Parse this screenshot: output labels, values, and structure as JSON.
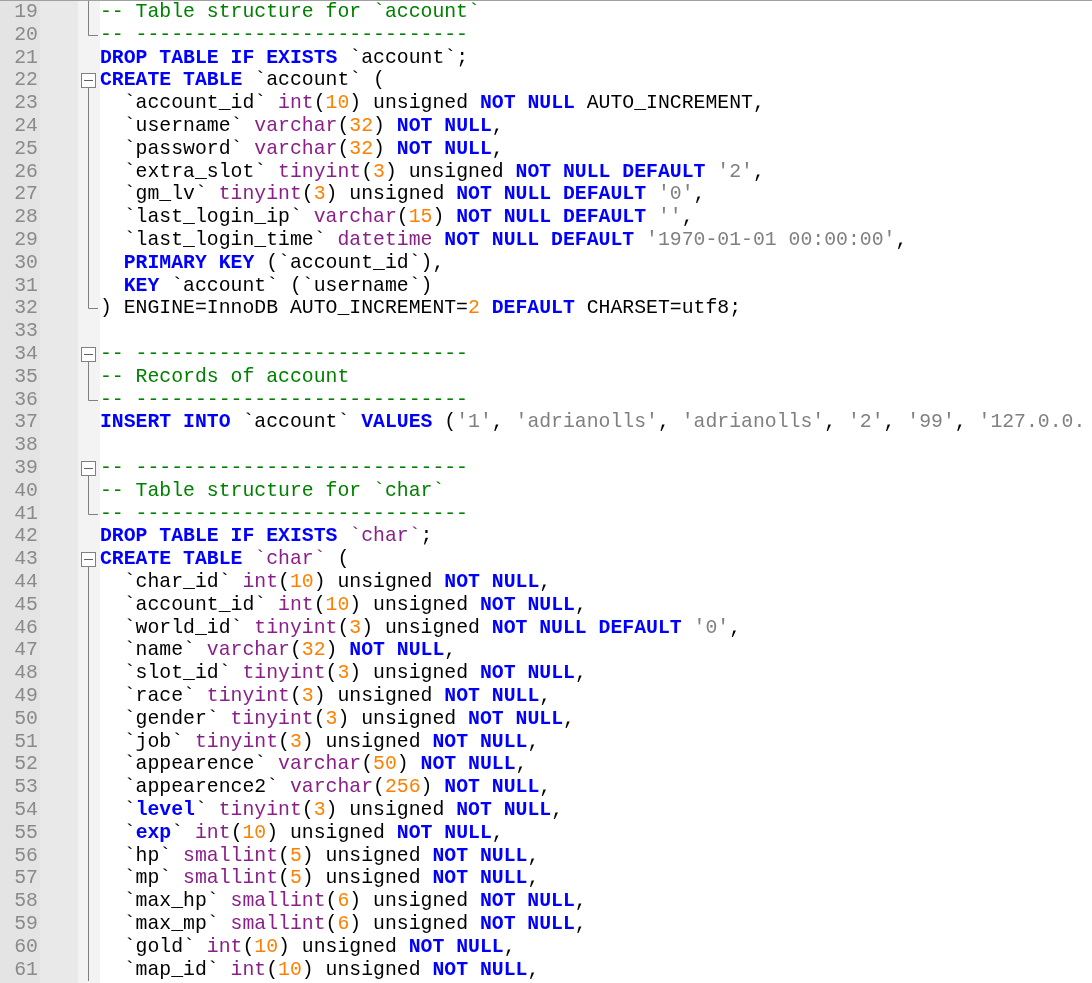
{
  "editor": {
    "lines": [
      {
        "number": "19",
        "kind": "body",
        "indented": false,
        "tokens": [
          {
            "kind": "comment",
            "text": "-- Table structure for `account`"
          }
        ]
      },
      {
        "number": "20",
        "kind": "end",
        "indented": false,
        "tokens": [
          {
            "kind": "comment",
            "text": "-- ----------------------------"
          }
        ]
      },
      {
        "number": "21",
        "kind": "plain",
        "indented": false,
        "tokens": [
          {
            "kind": "keyword",
            "text": "DROP TABLE IF EXISTS"
          },
          {
            "kind": "plain",
            "text": " `account`;"
          }
        ]
      },
      {
        "number": "22",
        "kind": "start",
        "indented": false,
        "tokens": [
          {
            "kind": "keyword",
            "text": "CREATE TABLE"
          },
          {
            "kind": "plain",
            "text": " `account` ("
          }
        ]
      },
      {
        "number": "23",
        "kind": "body",
        "indented": true,
        "tokens": [
          {
            "kind": "plain",
            "text": "`account_id` "
          },
          {
            "kind": "type",
            "text": "int"
          },
          {
            "kind": "plain",
            "text": "("
          },
          {
            "kind": "number",
            "text": "10"
          },
          {
            "kind": "plain",
            "text": ") unsigned "
          },
          {
            "kind": "keyword",
            "text": "NOT NULL"
          },
          {
            "kind": "plain",
            "text": " AUTO_INCREMENT,"
          }
        ]
      },
      {
        "number": "24",
        "kind": "body",
        "indented": true,
        "tokens": [
          {
            "kind": "plain",
            "text": "`username` "
          },
          {
            "kind": "type",
            "text": "varchar"
          },
          {
            "kind": "plain",
            "text": "("
          },
          {
            "kind": "number",
            "text": "32"
          },
          {
            "kind": "plain",
            "text": ") "
          },
          {
            "kind": "keyword",
            "text": "NOT NULL"
          },
          {
            "kind": "plain",
            "text": ","
          }
        ]
      },
      {
        "number": "25",
        "kind": "body",
        "indented": true,
        "tokens": [
          {
            "kind": "plain",
            "text": "`password` "
          },
          {
            "kind": "type",
            "text": "varchar"
          },
          {
            "kind": "plain",
            "text": "("
          },
          {
            "kind": "number",
            "text": "32"
          },
          {
            "kind": "plain",
            "text": ") "
          },
          {
            "kind": "keyword",
            "text": "NOT NULL"
          },
          {
            "kind": "plain",
            "text": ","
          }
        ]
      },
      {
        "number": "26",
        "kind": "body",
        "indented": true,
        "tokens": [
          {
            "kind": "plain",
            "text": "`extra_slot` "
          },
          {
            "kind": "type",
            "text": "tinyint"
          },
          {
            "kind": "plain",
            "text": "("
          },
          {
            "kind": "number",
            "text": "3"
          },
          {
            "kind": "plain",
            "text": ") unsigned "
          },
          {
            "kind": "keyword",
            "text": "NOT NULL DEFAULT"
          },
          {
            "kind": "string",
            "text": " '2'"
          },
          {
            "kind": "plain",
            "text": ","
          }
        ]
      },
      {
        "number": "27",
        "kind": "body",
        "indented": true,
        "tokens": [
          {
            "kind": "plain",
            "text": "`gm_lv` "
          },
          {
            "kind": "type",
            "text": "tinyint"
          },
          {
            "kind": "plain",
            "text": "("
          },
          {
            "kind": "number",
            "text": "3"
          },
          {
            "kind": "plain",
            "text": ") unsigned "
          },
          {
            "kind": "keyword",
            "text": "NOT NULL DEFAULT"
          },
          {
            "kind": "string",
            "text": " '0'"
          },
          {
            "kind": "plain",
            "text": ","
          }
        ]
      },
      {
        "number": "28",
        "kind": "body",
        "indented": true,
        "tokens": [
          {
            "kind": "plain",
            "text": "`last_login_ip` "
          },
          {
            "kind": "type",
            "text": "varchar"
          },
          {
            "kind": "plain",
            "text": "("
          },
          {
            "kind": "number",
            "text": "15"
          },
          {
            "kind": "plain",
            "text": ") "
          },
          {
            "kind": "keyword",
            "text": "NOT NULL DEFAULT"
          },
          {
            "kind": "string",
            "text": " ''"
          },
          {
            "kind": "plain",
            "text": ","
          }
        ]
      },
      {
        "number": "29",
        "kind": "body",
        "indented": true,
        "tokens": [
          {
            "kind": "plain",
            "text": "`last_login_time` "
          },
          {
            "kind": "type",
            "text": "datetime"
          },
          {
            "kind": "keyword",
            "text": " NOT NULL DEFAULT"
          },
          {
            "kind": "string",
            "text": " '1970-01-01 00:00:00'"
          },
          {
            "kind": "plain",
            "text": ","
          }
        ]
      },
      {
        "number": "30",
        "kind": "body",
        "indented": true,
        "tokens": [
          {
            "kind": "keyword",
            "text": "PRIMARY KEY"
          },
          {
            "kind": "plain",
            "text": " (`account_id`),"
          }
        ]
      },
      {
        "number": "31",
        "kind": "body",
        "indented": true,
        "tokens": [
          {
            "kind": "keyword",
            "text": "KEY"
          },
          {
            "kind": "plain",
            "text": " `account` (`username`)"
          }
        ]
      },
      {
        "number": "32",
        "kind": "end",
        "indented": false,
        "tokens": [
          {
            "kind": "plain",
            "text": ") ENGINE=InnoDB AUTO_INCREMENT="
          },
          {
            "kind": "number",
            "text": "2"
          },
          {
            "kind": "keyword",
            "text": " DEFAULT"
          },
          {
            "kind": "plain",
            "text": " CHARSET=utf8;"
          }
        ]
      },
      {
        "number": "33",
        "kind": "plain"
      },
      {
        "number": "34",
        "kind": "start",
        "indented": false,
        "tokens": [
          {
            "kind": "comment",
            "text": "-- ----------------------------"
          }
        ]
      },
      {
        "number": "35",
        "kind": "body",
        "indented": false,
        "tokens": [
          {
            "kind": "comment",
            "text": "-- Records of account"
          }
        ]
      },
      {
        "number": "36",
        "kind": "end",
        "indented": false,
        "tokens": [
          {
            "kind": "comment",
            "text": "-- ----------------------------"
          }
        ]
      },
      {
        "number": "37",
        "kind": "plain",
        "indented": false,
        "tokens": [
          {
            "kind": "keyword",
            "text": "INSERT INTO"
          },
          {
            "kind": "plain",
            "text": " `account` "
          },
          {
            "kind": "keyword",
            "text": "VALUES"
          },
          {
            "kind": "plain",
            "text": " ("
          },
          {
            "kind": "string",
            "text": "'1'"
          },
          {
            "kind": "plain",
            "text": ","
          },
          {
            "kind": "string",
            "text": " 'adrianolls'"
          },
          {
            "kind": "plain",
            "text": ","
          },
          {
            "kind": "string",
            "text": " 'adrianolls'"
          },
          {
            "kind": "plain",
            "text": ","
          },
          {
            "kind": "string",
            "text": " '2'"
          },
          {
            "kind": "plain",
            "text": ","
          },
          {
            "kind": "string",
            "text": " '99'"
          },
          {
            "kind": "plain",
            "text": ","
          },
          {
            "kind": "string",
            "text": " '127.0.0."
          }
        ]
      },
      {
        "number": "38",
        "kind": "plain"
      },
      {
        "number": "39",
        "kind": "start",
        "indented": false,
        "tokens": [
          {
            "kind": "comment",
            "text": "-- ----------------------------"
          }
        ]
      },
      {
        "number": "40",
        "kind": "body",
        "indented": false,
        "tokens": [
          {
            "kind": "comment",
            "text": "-- Table structure for `char`"
          }
        ]
      },
      {
        "number": "41",
        "kind": "end",
        "indented": false,
        "tokens": [
          {
            "kind": "comment",
            "text": "-- ----------------------------"
          }
        ]
      },
      {
        "number": "42",
        "kind": "plain",
        "indented": false,
        "tokens": [
          {
            "kind": "keyword",
            "text": "DROP TABLE IF EXISTS"
          },
          {
            "kind": "type",
            "text": " `char`"
          },
          {
            "kind": "plain",
            "text": ";"
          }
        ]
      },
      {
        "number": "43",
        "kind": "start",
        "indented": false,
        "tokens": [
          {
            "kind": "keyword",
            "text": "CREATE TABLE"
          },
          {
            "kind": "type",
            "text": " `char`"
          },
          {
            "kind": "plain",
            "text": " ("
          }
        ]
      },
      {
        "number": "44",
        "kind": "body",
        "indented": true,
        "tokens": [
          {
            "kind": "plain",
            "text": "`char_id` "
          },
          {
            "kind": "type",
            "text": "int"
          },
          {
            "kind": "plain",
            "text": "("
          },
          {
            "kind": "number",
            "text": "10"
          },
          {
            "kind": "plain",
            "text": ") unsigned "
          },
          {
            "kind": "keyword",
            "text": "NOT NULL"
          },
          {
            "kind": "plain",
            "text": ","
          }
        ]
      },
      {
        "number": "45",
        "kind": "body",
        "indented": true,
        "tokens": [
          {
            "kind": "plain",
            "text": "`account_id` "
          },
          {
            "kind": "type",
            "text": "int"
          },
          {
            "kind": "plain",
            "text": "("
          },
          {
            "kind": "number",
            "text": "10"
          },
          {
            "kind": "plain",
            "text": ") unsigned "
          },
          {
            "kind": "keyword",
            "text": "NOT NULL"
          },
          {
            "kind": "plain",
            "text": ","
          }
        ]
      },
      {
        "number": "46",
        "kind": "body",
        "indented": true,
        "tokens": [
          {
            "kind": "plain",
            "text": "`world_id` "
          },
          {
            "kind": "type",
            "text": "tinyint"
          },
          {
            "kind": "plain",
            "text": "("
          },
          {
            "kind": "number",
            "text": "3"
          },
          {
            "kind": "plain",
            "text": ") unsigned "
          },
          {
            "kind": "keyword",
            "text": "NOT NULL DEFAULT"
          },
          {
            "kind": "string",
            "text": " '0'"
          },
          {
            "kind": "plain",
            "text": ","
          }
        ]
      },
      {
        "number": "47",
        "kind": "body",
        "indented": true,
        "tokens": [
          {
            "kind": "plain",
            "text": "`name` "
          },
          {
            "kind": "type",
            "text": "varchar"
          },
          {
            "kind": "plain",
            "text": "("
          },
          {
            "kind": "number",
            "text": "32"
          },
          {
            "kind": "plain",
            "text": ") "
          },
          {
            "kind": "keyword",
            "text": "NOT NULL"
          },
          {
            "kind": "plain",
            "text": ","
          }
        ]
      },
      {
        "number": "48",
        "kind": "body",
        "indented": true,
        "tokens": [
          {
            "kind": "plain",
            "text": "`slot_id` "
          },
          {
            "kind": "type",
            "text": "tinyint"
          },
          {
            "kind": "plain",
            "text": "("
          },
          {
            "kind": "number",
            "text": "3"
          },
          {
            "kind": "plain",
            "text": ") unsigned "
          },
          {
            "kind": "keyword",
            "text": "NOT NULL"
          },
          {
            "kind": "plain",
            "text": ","
          }
        ]
      },
      {
        "number": "49",
        "kind": "body",
        "indented": true,
        "tokens": [
          {
            "kind": "plain",
            "text": "`race` "
          },
          {
            "kind": "type",
            "text": "tinyint"
          },
          {
            "kind": "plain",
            "text": "("
          },
          {
            "kind": "number",
            "text": "3"
          },
          {
            "kind": "plain",
            "text": ") unsigned "
          },
          {
            "kind": "keyword",
            "text": "NOT NULL"
          },
          {
            "kind": "plain",
            "text": ","
          }
        ]
      },
      {
        "number": "50",
        "kind": "body",
        "indented": true,
        "tokens": [
          {
            "kind": "plain",
            "text": "`gender` "
          },
          {
            "kind": "type",
            "text": "tinyint"
          },
          {
            "kind": "plain",
            "text": "("
          },
          {
            "kind": "number",
            "text": "3"
          },
          {
            "kind": "plain",
            "text": ") unsigned "
          },
          {
            "kind": "keyword",
            "text": "NOT NULL"
          },
          {
            "kind": "plain",
            "text": ","
          }
        ]
      },
      {
        "number": "51",
        "kind": "body",
        "indented": true,
        "tokens": [
          {
            "kind": "plain",
            "text": "`job` "
          },
          {
            "kind": "type",
            "text": "tinyint"
          },
          {
            "kind": "plain",
            "text": "("
          },
          {
            "kind": "number",
            "text": "3"
          },
          {
            "kind": "plain",
            "text": ") unsigned "
          },
          {
            "kind": "keyword",
            "text": "NOT NULL"
          },
          {
            "kind": "plain",
            "text": ","
          }
        ]
      },
      {
        "number": "52",
        "kind": "body",
        "indented": true,
        "tokens": [
          {
            "kind": "plain",
            "text": "`appearence` "
          },
          {
            "kind": "type",
            "text": "varchar"
          },
          {
            "kind": "plain",
            "text": "("
          },
          {
            "kind": "number",
            "text": "50"
          },
          {
            "kind": "plain",
            "text": ") "
          },
          {
            "kind": "keyword",
            "text": "NOT NULL"
          },
          {
            "kind": "plain",
            "text": ","
          }
        ]
      },
      {
        "number": "53",
        "kind": "body",
        "indented": true,
        "tokens": [
          {
            "kind": "plain",
            "text": "`appearence2` "
          },
          {
            "kind": "type",
            "text": "varchar"
          },
          {
            "kind": "plain",
            "text": "("
          },
          {
            "kind": "number",
            "text": "256"
          },
          {
            "kind": "plain",
            "text": ") "
          },
          {
            "kind": "keyword",
            "text": "NOT NULL"
          },
          {
            "kind": "plain",
            "text": ","
          }
        ]
      },
      {
        "number": "54",
        "kind": "body",
        "indented": true,
        "tokens": [
          {
            "kind": "plain",
            "text": "`"
          },
          {
            "kind": "keyword",
            "text": "level"
          },
          {
            "kind": "plain",
            "text": "` "
          },
          {
            "kind": "type",
            "text": "tinyint"
          },
          {
            "kind": "plain",
            "text": "("
          },
          {
            "kind": "number",
            "text": "3"
          },
          {
            "kind": "plain",
            "text": ") unsigned "
          },
          {
            "kind": "keyword",
            "text": "NOT NULL"
          },
          {
            "kind": "plain",
            "text": ","
          }
        ]
      },
      {
        "number": "55",
        "kind": "body",
        "indented": true,
        "tokens": [
          {
            "kind": "plain",
            "text": "`"
          },
          {
            "kind": "keyword",
            "text": "exp"
          },
          {
            "kind": "plain",
            "text": "` "
          },
          {
            "kind": "type",
            "text": "int"
          },
          {
            "kind": "plain",
            "text": "("
          },
          {
            "kind": "number",
            "text": "10"
          },
          {
            "kind": "plain",
            "text": ") unsigned "
          },
          {
            "kind": "keyword",
            "text": "NOT NULL"
          },
          {
            "kind": "plain",
            "text": ","
          }
        ]
      },
      {
        "number": "56",
        "kind": "body",
        "indented": true,
        "tokens": [
          {
            "kind": "plain",
            "text": "`hp` "
          },
          {
            "kind": "type",
            "text": "smallint"
          },
          {
            "kind": "plain",
            "text": "("
          },
          {
            "kind": "number",
            "text": "5"
          },
          {
            "kind": "plain",
            "text": ") unsigned "
          },
          {
            "kind": "keyword",
            "text": "NOT NULL"
          },
          {
            "kind": "plain",
            "text": ","
          }
        ]
      },
      {
        "number": "57",
        "kind": "body",
        "indented": true,
        "tokens": [
          {
            "kind": "plain",
            "text": "`mp` "
          },
          {
            "kind": "type",
            "text": "smallint"
          },
          {
            "kind": "plain",
            "text": "("
          },
          {
            "kind": "number",
            "text": "5"
          },
          {
            "kind": "plain",
            "text": ") unsigned "
          },
          {
            "kind": "keyword",
            "text": "NOT NULL"
          },
          {
            "kind": "plain",
            "text": ","
          }
        ]
      },
      {
        "number": "58",
        "kind": "body",
        "indented": true,
        "tokens": [
          {
            "kind": "plain",
            "text": "`max_hp` "
          },
          {
            "kind": "type",
            "text": "smallint"
          },
          {
            "kind": "plain",
            "text": "("
          },
          {
            "kind": "number",
            "text": "6"
          },
          {
            "kind": "plain",
            "text": ") unsigned "
          },
          {
            "kind": "keyword",
            "text": "NOT NULL"
          },
          {
            "kind": "plain",
            "text": ","
          }
        ]
      },
      {
        "number": "59",
        "kind": "body",
        "indented": true,
        "tokens": [
          {
            "kind": "plain",
            "text": "`max_mp` "
          },
          {
            "kind": "type",
            "text": "smallint"
          },
          {
            "kind": "plain",
            "text": "("
          },
          {
            "kind": "number",
            "text": "6"
          },
          {
            "kind": "plain",
            "text": ") unsigned "
          },
          {
            "kind": "keyword",
            "text": "NOT NULL"
          },
          {
            "kind": "plain",
            "text": ","
          }
        ]
      },
      {
        "number": "60",
        "kind": "body",
        "indented": true,
        "tokens": [
          {
            "kind": "plain",
            "text": "`gold` "
          },
          {
            "kind": "type",
            "text": "int"
          },
          {
            "kind": "plain",
            "text": "("
          },
          {
            "kind": "number",
            "text": "10"
          },
          {
            "kind": "plain",
            "text": ") unsigned "
          },
          {
            "kind": "keyword",
            "text": "NOT NULL"
          },
          {
            "kind": "plain",
            "text": ","
          }
        ]
      },
      {
        "number": "61",
        "kind": "body",
        "indented": true,
        "tokens": [
          {
            "kind": "plain",
            "text": "`map_id` "
          },
          {
            "kind": "type",
            "text": "int"
          },
          {
            "kind": "plain",
            "text": "("
          },
          {
            "kind": "number",
            "text": "10"
          },
          {
            "kind": "plain",
            "text": ") unsigned "
          },
          {
            "kind": "keyword",
            "text": "NOT NULL"
          },
          {
            "kind": "plain",
            "text": ","
          }
        ]
      }
    ]
  }
}
